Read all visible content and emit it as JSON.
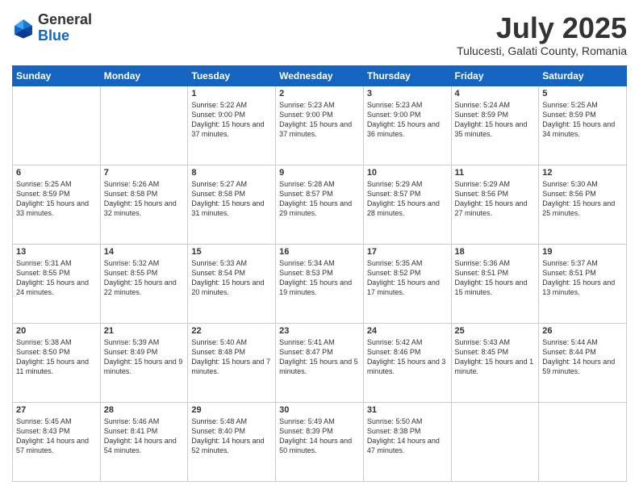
{
  "logo": {
    "general": "General",
    "blue": "Blue"
  },
  "title": {
    "month": "July 2025",
    "location": "Tulucesti, Galati County, Romania"
  },
  "weekdays": [
    "Sunday",
    "Monday",
    "Tuesday",
    "Wednesday",
    "Thursday",
    "Friday",
    "Saturday"
  ],
  "weeks": [
    [
      {
        "day": "",
        "content": ""
      },
      {
        "day": "",
        "content": ""
      },
      {
        "day": "1",
        "content": "Sunrise: 5:22 AM\nSunset: 9:00 PM\nDaylight: 15 hours and 37 minutes."
      },
      {
        "day": "2",
        "content": "Sunrise: 5:23 AM\nSunset: 9:00 PM\nDaylight: 15 hours and 37 minutes."
      },
      {
        "day": "3",
        "content": "Sunrise: 5:23 AM\nSunset: 9:00 PM\nDaylight: 15 hours and 36 minutes."
      },
      {
        "day": "4",
        "content": "Sunrise: 5:24 AM\nSunset: 8:59 PM\nDaylight: 15 hours and 35 minutes."
      },
      {
        "day": "5",
        "content": "Sunrise: 5:25 AM\nSunset: 8:59 PM\nDaylight: 15 hours and 34 minutes."
      }
    ],
    [
      {
        "day": "6",
        "content": "Sunrise: 5:25 AM\nSunset: 8:59 PM\nDaylight: 15 hours and 33 minutes."
      },
      {
        "day": "7",
        "content": "Sunrise: 5:26 AM\nSunset: 8:58 PM\nDaylight: 15 hours and 32 minutes."
      },
      {
        "day": "8",
        "content": "Sunrise: 5:27 AM\nSunset: 8:58 PM\nDaylight: 15 hours and 31 minutes."
      },
      {
        "day": "9",
        "content": "Sunrise: 5:28 AM\nSunset: 8:57 PM\nDaylight: 15 hours and 29 minutes."
      },
      {
        "day": "10",
        "content": "Sunrise: 5:29 AM\nSunset: 8:57 PM\nDaylight: 15 hours and 28 minutes."
      },
      {
        "day": "11",
        "content": "Sunrise: 5:29 AM\nSunset: 8:56 PM\nDaylight: 15 hours and 27 minutes."
      },
      {
        "day": "12",
        "content": "Sunrise: 5:30 AM\nSunset: 8:56 PM\nDaylight: 15 hours and 25 minutes."
      }
    ],
    [
      {
        "day": "13",
        "content": "Sunrise: 5:31 AM\nSunset: 8:55 PM\nDaylight: 15 hours and 24 minutes."
      },
      {
        "day": "14",
        "content": "Sunrise: 5:32 AM\nSunset: 8:55 PM\nDaylight: 15 hours and 22 minutes."
      },
      {
        "day": "15",
        "content": "Sunrise: 5:33 AM\nSunset: 8:54 PM\nDaylight: 15 hours and 20 minutes."
      },
      {
        "day": "16",
        "content": "Sunrise: 5:34 AM\nSunset: 8:53 PM\nDaylight: 15 hours and 19 minutes."
      },
      {
        "day": "17",
        "content": "Sunrise: 5:35 AM\nSunset: 8:52 PM\nDaylight: 15 hours and 17 minutes."
      },
      {
        "day": "18",
        "content": "Sunrise: 5:36 AM\nSunset: 8:51 PM\nDaylight: 15 hours and 15 minutes."
      },
      {
        "day": "19",
        "content": "Sunrise: 5:37 AM\nSunset: 8:51 PM\nDaylight: 15 hours and 13 minutes."
      }
    ],
    [
      {
        "day": "20",
        "content": "Sunrise: 5:38 AM\nSunset: 8:50 PM\nDaylight: 15 hours and 11 minutes."
      },
      {
        "day": "21",
        "content": "Sunrise: 5:39 AM\nSunset: 8:49 PM\nDaylight: 15 hours and 9 minutes."
      },
      {
        "day": "22",
        "content": "Sunrise: 5:40 AM\nSunset: 8:48 PM\nDaylight: 15 hours and 7 minutes."
      },
      {
        "day": "23",
        "content": "Sunrise: 5:41 AM\nSunset: 8:47 PM\nDaylight: 15 hours and 5 minutes."
      },
      {
        "day": "24",
        "content": "Sunrise: 5:42 AM\nSunset: 8:46 PM\nDaylight: 15 hours and 3 minutes."
      },
      {
        "day": "25",
        "content": "Sunrise: 5:43 AM\nSunset: 8:45 PM\nDaylight: 15 hours and 1 minute."
      },
      {
        "day": "26",
        "content": "Sunrise: 5:44 AM\nSunset: 8:44 PM\nDaylight: 14 hours and 59 minutes."
      }
    ],
    [
      {
        "day": "27",
        "content": "Sunrise: 5:45 AM\nSunset: 8:43 PM\nDaylight: 14 hours and 57 minutes."
      },
      {
        "day": "28",
        "content": "Sunrise: 5:46 AM\nSunset: 8:41 PM\nDaylight: 14 hours and 54 minutes."
      },
      {
        "day": "29",
        "content": "Sunrise: 5:48 AM\nSunset: 8:40 PM\nDaylight: 14 hours and 52 minutes."
      },
      {
        "day": "30",
        "content": "Sunrise: 5:49 AM\nSunset: 8:39 PM\nDaylight: 14 hours and 50 minutes."
      },
      {
        "day": "31",
        "content": "Sunrise: 5:50 AM\nSunset: 8:38 PM\nDaylight: 14 hours and 47 minutes."
      },
      {
        "day": "",
        "content": ""
      },
      {
        "day": "",
        "content": ""
      }
    ]
  ]
}
